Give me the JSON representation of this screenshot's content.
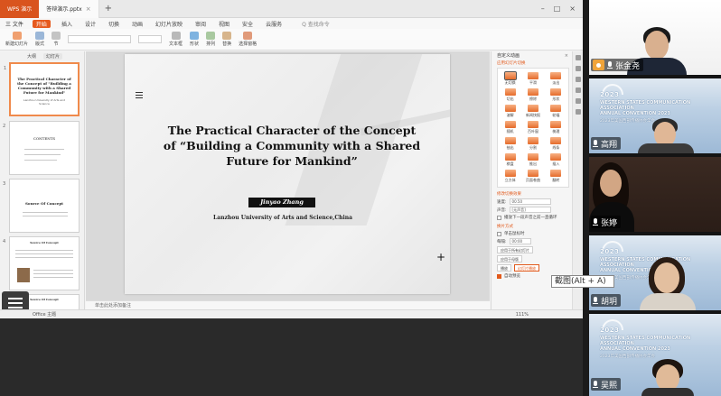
{
  "wps": {
    "app_tab": "WPS 演示",
    "doc_tab": "答辩演示.pptx",
    "menu": {
      "file": "三 文件",
      "items": [
        "开始",
        "插入",
        "设计",
        "切换",
        "动画",
        "幻灯片放映",
        "审阅",
        "视图",
        "安全",
        "云服务"
      ],
      "active_index": 0,
      "search": "Q 查找命令"
    },
    "ribbon": {
      "font_name": "",
      "groups": [
        "新建幻灯片",
        "版式",
        "节",
        "文本框",
        "形状",
        "排列",
        "替换",
        "选择窗格"
      ]
    },
    "pane_tabs": [
      "大纲",
      "幻灯片"
    ],
    "pane_selected": 1,
    "thumbnails": [
      {
        "num": "1",
        "title": "The Practical Character of the Concept of \"Building a Community with a Shared Future for Mankind\"",
        "sub": "Lanzhou University of Arts and Science"
      },
      {
        "num": "2",
        "title": "CONTENTS",
        "sub": ""
      },
      {
        "num": "3",
        "title": "Source Of Concept",
        "sub": ""
      },
      {
        "num": "4",
        "title": "Source Of Concept",
        "sub": ""
      },
      {
        "num": "5",
        "title": "Source Of Concept",
        "sub": ""
      }
    ],
    "slide": {
      "title": "The Practical Character of the Concept of “Building a Community with a Shared Future for Mankind”",
      "author": "Jinyao Zhang",
      "affiliation": "Lanzhou University of Arts and Science,China"
    },
    "notes_placeholder": "单击此处添加备注",
    "status": {
      "slide_info": "Office 主题",
      "zoom": "111%"
    },
    "right_pane": {
      "title": "自定义动画",
      "subtitle": "应用幻灯片切换",
      "effects": [
        "无切换",
        "平滑",
        "淡出",
        "切出",
        "擦除",
        "形状",
        "溶解",
        "新闻快报",
        "轮辐",
        "随机",
        "百叶窗",
        "梳理",
        "抽出",
        "分割",
        "线条",
        "棋盘",
        "推出",
        "插入",
        "立方体",
        "页面卷曲",
        "翻转"
      ],
      "selected_effect": 0,
      "section_modify": "修改切换效果",
      "speed_label": "速度:",
      "speed_value": "00.50",
      "sound_label": "声音:",
      "sound_value": "[无声音]",
      "loop_label": "播放下一段声音之前一直循环",
      "section_advance": "换片方式",
      "on_click": "单击鼠标时",
      "every_label": "每隔:",
      "every_value": "00:00",
      "apply_all": "应用于所有幻灯片",
      "apply_master": "应用于母版",
      "play_btn": "播放",
      "show_btn": "幻灯片播放",
      "autopreview": "自动预览"
    },
    "tooltip": "截图(Alt + A)"
  },
  "participants": [
    {
      "name": "张金尧",
      "badge": true,
      "banner": false
    },
    {
      "name": "高翔",
      "badge": false,
      "banner": true,
      "year": "2023",
      "line1": "WESTERN STATES COMMUNICATION ASSOCIATION",
      "line2": "ANNUAL CONVENTION 2023",
      "line3": "2023年美国西部传播协会年会"
    },
    {
      "name": "张婷",
      "badge": false,
      "banner": false
    },
    {
      "name": "胡玥",
      "badge": false,
      "banner": true,
      "year": "2023",
      "line1": "WESTERN STATES COMMUNICATION ASSOCIATION",
      "line2": "ANNUAL CONVENTION 2023",
      "line3": "2023年美国西部传播协会年会"
    },
    {
      "name": "吴熙",
      "badge": false,
      "banner": true,
      "year": "2023",
      "line1": "WESTERN STATES COMMUNICATION ASSOCIATION",
      "line2": "ANNUAL CONVENTION 2023",
      "line3": "2023年美国西部传播协会年会"
    }
  ],
  "colors": {
    "accent": "#e65a1e",
    "conference_blue": "#2b5a8c",
    "badge": "#f0a43a"
  }
}
